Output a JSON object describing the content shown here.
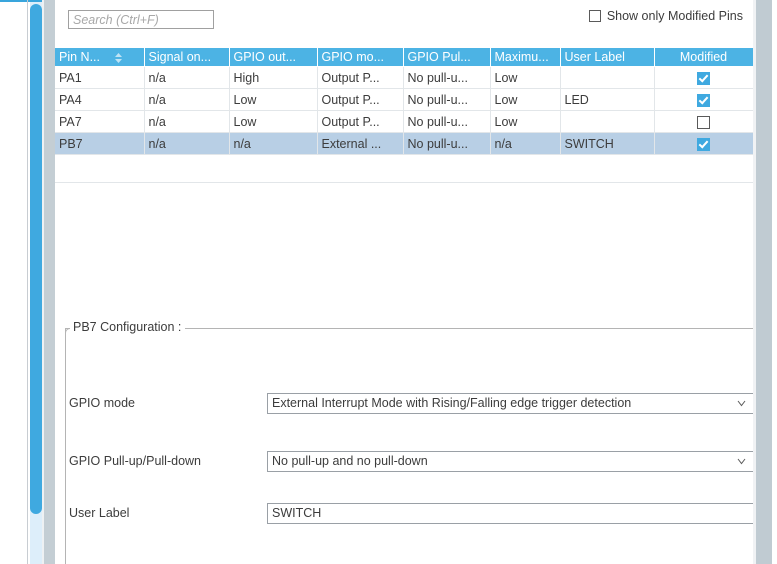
{
  "toolbar": {
    "search_placeholder": "Search (Ctrl+F)",
    "search_value": "",
    "show_modified_label": "Show only Modified Pins",
    "show_modified_checked": false
  },
  "table": {
    "columns": [
      {
        "label": "Pin N...",
        "sorted": true,
        "align": "left"
      },
      {
        "label": "Signal on...",
        "sorted": false,
        "align": "left"
      },
      {
        "label": "GPIO out...",
        "sorted": false,
        "align": "left"
      },
      {
        "label": "GPIO mo...",
        "sorted": false,
        "align": "left"
      },
      {
        "label": "GPIO Pul...",
        "sorted": false,
        "align": "left"
      },
      {
        "label": "Maximu...",
        "sorted": false,
        "align": "left"
      },
      {
        "label": "User Label",
        "sorted": false,
        "align": "left"
      },
      {
        "label": "Modified",
        "sorted": false,
        "align": "center"
      }
    ],
    "rows": [
      {
        "pin_name": "PA1",
        "signal_on_pin": "n/a",
        "gpio_output_level": "High",
        "gpio_mode": "Output P...",
        "gpio_pull": "No pull-u...",
        "maximum_speed": "Low",
        "user_label": "",
        "modified": true,
        "selected": false
      },
      {
        "pin_name": "PA4",
        "signal_on_pin": "n/a",
        "gpio_output_level": "Low",
        "gpio_mode": "Output P...",
        "gpio_pull": "No pull-u...",
        "maximum_speed": "Low",
        "user_label": "LED",
        "modified": true,
        "selected": false
      },
      {
        "pin_name": "PA7",
        "signal_on_pin": "n/a",
        "gpio_output_level": "Low",
        "gpio_mode": "Output P...",
        "gpio_pull": "No pull-u...",
        "maximum_speed": "Low",
        "user_label": "",
        "modified": false,
        "selected": false
      },
      {
        "pin_name": "PB7",
        "signal_on_pin": "n/a",
        "gpio_output_level": "n/a",
        "gpio_mode": "External ...",
        "gpio_pull": "No pull-u...",
        "maximum_speed": "n/a",
        "user_label": "SWITCH",
        "modified": true,
        "selected": true
      }
    ]
  },
  "config": {
    "group_title": "PB7 Configuration :",
    "fields": [
      {
        "label": "GPIO mode",
        "value": "External Interrupt Mode with Rising/Falling edge trigger detection",
        "control": "combobox"
      },
      {
        "label": "GPIO Pull-up/Pull-down",
        "value": "No pull-up and no pull-down",
        "control": "combobox"
      },
      {
        "label": "User Label",
        "value": "SWITCH",
        "control": "textbox"
      }
    ]
  },
  "colors": {
    "header_blue": "#4cb3e4",
    "accent_blue": "#3fa9e0",
    "selection_blue": "#b8cfe5",
    "gutter_gray": "#c0cbd2",
    "text": "#3c3c3c"
  }
}
